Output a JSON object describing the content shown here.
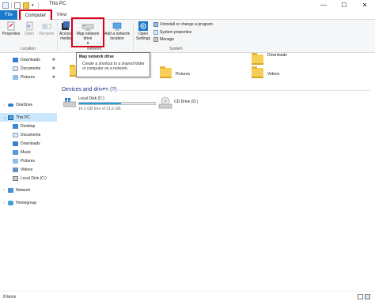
{
  "window": {
    "title": "This PC",
    "minimize": "—",
    "maximize": "☐",
    "close": "✕"
  },
  "tabs": {
    "file": "File",
    "computer": "Computer",
    "view": "View"
  },
  "ribbon": {
    "properties": "Properties",
    "open": "Open",
    "rename": "Rename",
    "access_media": "Access media",
    "map_network_drive": "Map network drive",
    "add_network_location": "Add a network location",
    "open_settings": "Open Settings",
    "uninstall": "Uninstall or change a program",
    "system_properties": "System properties",
    "manage": "Manage",
    "group_location": "Location",
    "group_network": "Network",
    "group_system": "System"
  },
  "tooltip": {
    "title": "Map network drive",
    "body": "Create a shortcut to a shared folder or computer on a network."
  },
  "nav": {
    "quick_access": [
      {
        "label": "Downloads",
        "pinned": true
      },
      {
        "label": "Documents",
        "pinned": true
      },
      {
        "label": "Pictures",
        "pinned": true
      }
    ],
    "onedrive": "OneDrive",
    "this_pc": "This PC",
    "this_pc_children": [
      "Desktop",
      "Documents",
      "Downloads",
      "Music",
      "Pictures",
      "Videos",
      "Local Disk (C:)"
    ],
    "network": "Network",
    "homegroup": "Homegroup"
  },
  "folders": {
    "downloads": "Downloads",
    "pictures": "Pictures",
    "videos": "Videos"
  },
  "devices": {
    "header": "Devices and drives (2)",
    "local_disk": {
      "label": "Local Disk (C:)",
      "free": "14.1 GB free of 31.5 GB",
      "used_fraction": 0.55
    },
    "cd_drive": {
      "label": "CD Drive (D:)"
    }
  },
  "status": {
    "items": "8 items"
  },
  "colors": {
    "accent": "#1979ca",
    "highlight": "#d9001b",
    "selected": "#cce8ff",
    "bar": "#26a0da"
  }
}
